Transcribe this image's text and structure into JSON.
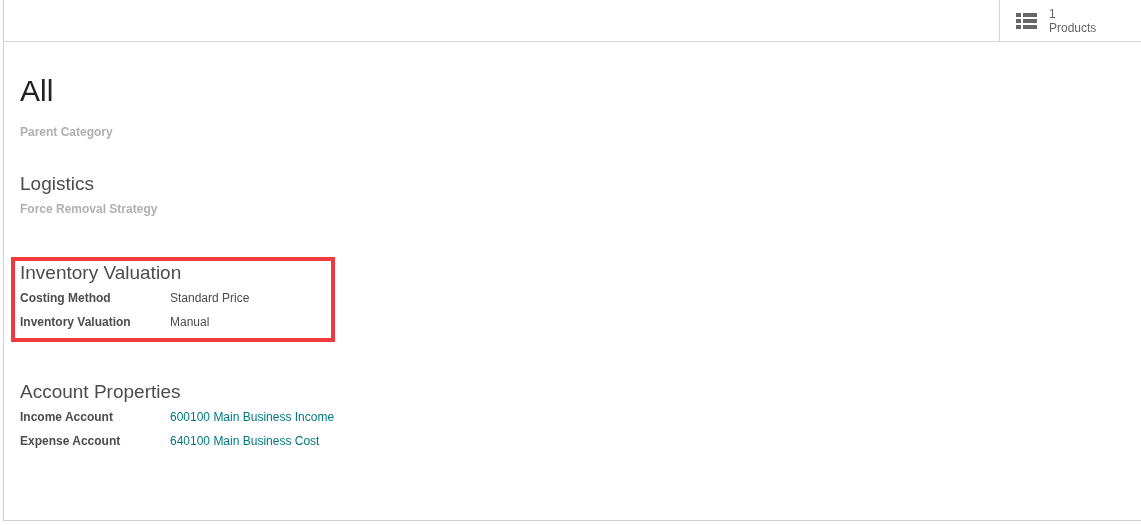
{
  "button_box": {
    "count": "1",
    "label": "Products"
  },
  "title": "All",
  "top_fields": [
    {
      "label": "Parent Category",
      "kind": "empty"
    }
  ],
  "sections": [
    {
      "title": "Logistics",
      "highlighted": false,
      "fields": [
        {
          "label": "Force Removal Strategy",
          "kind": "empty"
        }
      ]
    },
    {
      "title": "Inventory Valuation",
      "highlighted": true,
      "fields": [
        {
          "label": "Costing Method",
          "kind": "text",
          "value": "Standard Price"
        },
        {
          "label": "Inventory Valuation",
          "kind": "text",
          "value": "Manual"
        }
      ]
    },
    {
      "title": "Account Properties",
      "highlighted": false,
      "fields": [
        {
          "label": "Income Account",
          "kind": "link",
          "value": "600100 Main Business Income"
        },
        {
          "label": "Expense Account",
          "kind": "link",
          "value": "640100 Main Business Cost"
        }
      ]
    }
  ]
}
